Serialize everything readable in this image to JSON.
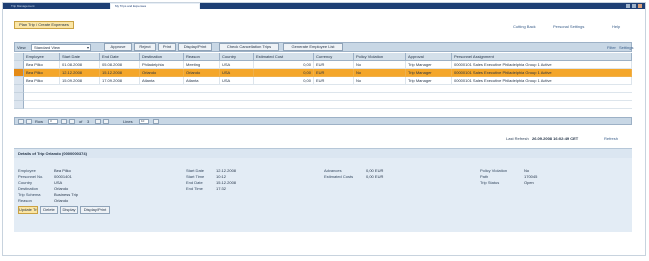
{
  "window": {
    "tabs": [
      {
        "label": "Trip Management"
      },
      {
        "label": "My Trips and Expenses"
      }
    ]
  },
  "header_links": [
    "Cutting Back",
    "Personal Settings",
    "Help"
  ],
  "top_button": "Plan Trip / Create Expenses",
  "toolbar": {
    "view_label": "View",
    "view_value": "Standard View",
    "buttons": [
      "Approve",
      "Reject",
      "Print",
      "Display/Print",
      "Check Cancellation Trips",
      "Generate Employee List"
    ],
    "right_links": [
      "Filter",
      "Settings"
    ]
  },
  "table": {
    "columns": [
      "Employee",
      "Start Date",
      "End Date",
      "Destination",
      "Reason",
      "Country",
      "Estimated Cost",
      "Currency",
      "Policy Violation",
      "Approval",
      "Personnel Assignment"
    ],
    "rows": [
      {
        "cells": [
          "Bea Pilko",
          "01.08.2008",
          "05.08.2008",
          "Philadelphia",
          "Meeting",
          "USA",
          "0,00",
          "EUR",
          "No",
          "Trip Manager",
          "00000101 Sales Executive Philadelphia Group 1 Active"
        ],
        "selected": false
      },
      {
        "cells": [
          "Bea Pilko",
          "12.12.2008",
          "15.12.2008",
          "Orlando",
          "Orlando",
          "USA",
          "0,00",
          "EUR",
          "No",
          "Trip Manager",
          "00000101 Sales Executive Philadelphia Group 1 Active"
        ],
        "selected": true
      },
      {
        "cells": [
          "Bea Pilko",
          "15.09.2008",
          "17.09.2008",
          "Atlanta",
          "Atlanta",
          "USA",
          "0,00",
          "EUR",
          "No",
          "Trip Manager",
          "00000101 Sales Executive Philadelphia Group 1 Active"
        ],
        "selected": false
      }
    ]
  },
  "pager": {
    "row_label": "Row",
    "row_value": "3",
    "of_label": "of",
    "of_value": "3",
    "items_label": "Lines",
    "items_value": "10"
  },
  "refresh": {
    "label": "Last Refresh",
    "value": "26.09.2008 16:02:49 CET",
    "link": "Refresh"
  },
  "details": {
    "title": "Details of Trip Orlando (0000000374)",
    "col1": [
      {
        "label": "Employee",
        "value": "Bea Pilko"
      },
      {
        "label": "Personnel No.",
        "value": "00001401"
      },
      {
        "label": "Country",
        "value": "USA"
      },
      {
        "label": "Destination",
        "value": "Orlando"
      },
      {
        "label": "Trip Schema",
        "value": "Business Trip"
      },
      {
        "label": "Reason",
        "value": "Orlando"
      }
    ],
    "col2": [
      {
        "label": "Start Date",
        "value": "12.12.2008"
      },
      {
        "label": "Start Time",
        "value": "10:12"
      },
      {
        "label": "End Date",
        "value": "15.12.2008"
      },
      {
        "label": "End Time",
        "value": "17:32"
      }
    ],
    "col3": [
      {
        "label": "Advances",
        "value": "0,00 EUR"
      },
      {
        "label": "Estimated Costs",
        "value": "0,00 EUR"
      }
    ],
    "col4": [
      {
        "label": "Policy Violation",
        "value": "No"
      },
      {
        "label": "Path",
        "value": "170045"
      },
      {
        "label": "Trip Status",
        "value": "Open"
      }
    ],
    "buttons": [
      "Update Trip",
      "Delete",
      "Display",
      "Display/Print"
    ]
  },
  "colors": {
    "selected_row": "#f4a62a",
    "title_bar": "#1e3f74",
    "header_bg": "#d4e0ea",
    "details_bg": "#e3ecf5"
  }
}
